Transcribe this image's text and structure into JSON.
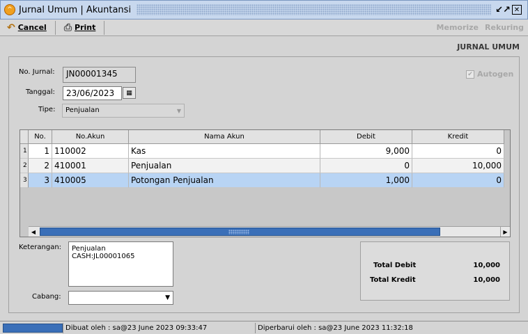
{
  "window": {
    "title": "Jurnal Umum | Akuntansi",
    "icon": "app-icon",
    "minimize_glyph": "↙↗",
    "close_glyph": "✕"
  },
  "toolbar": {
    "cancel_label": "Cancel",
    "cancel_icon": "undo-arrow-icon",
    "print_label": "Print",
    "print_icon": "printer-icon",
    "memorize_label": "Memorize",
    "rekuring_label": "Rekuring"
  },
  "header": {
    "heading": "JURNAL UMUM"
  },
  "form": {
    "no_jurnal_label": "No. Jurnal:",
    "no_jurnal_value": "JN00001345",
    "tanggal_label": "Tanggal:",
    "tanggal_value": "23/06/2023",
    "tipe_label": "Tipe:",
    "tipe_value": "Penjualan",
    "autogen_label": "Autogen",
    "autogen_checked": true,
    "keterangan_label": "Keterangan:",
    "keterangan_value": "Penjualan CASH:JL00001065",
    "cabang_label": "Cabang:",
    "cabang_value": ""
  },
  "grid": {
    "columns": [
      "No.",
      "No.Akun",
      "Nama Akun",
      "Debit",
      "Kredit"
    ],
    "rows": [
      {
        "rn": "1",
        "no": "1",
        "akun": "110002",
        "nama": "Kas",
        "debit": "9,000",
        "kredit": "0"
      },
      {
        "rn": "2",
        "no": "2",
        "akun": "410001",
        "nama": "Penjualan",
        "debit": "0",
        "kredit": "10,000"
      },
      {
        "rn": "3",
        "no": "3",
        "akun": "410005",
        "nama": "Potongan Penjualan",
        "debit": "1,000",
        "kredit": "0"
      }
    ],
    "selected_row": 3
  },
  "totals": {
    "debit_label": "Total Debit",
    "debit_value": "10,000",
    "kredit_label": "Total Kredit",
    "kredit_value": "10,000"
  },
  "status": {
    "created": "Dibuat oleh : sa@23 June 2023  09:33:47",
    "updated": "Diperbarui oleh : sa@23 June 2023  11:32:18"
  }
}
